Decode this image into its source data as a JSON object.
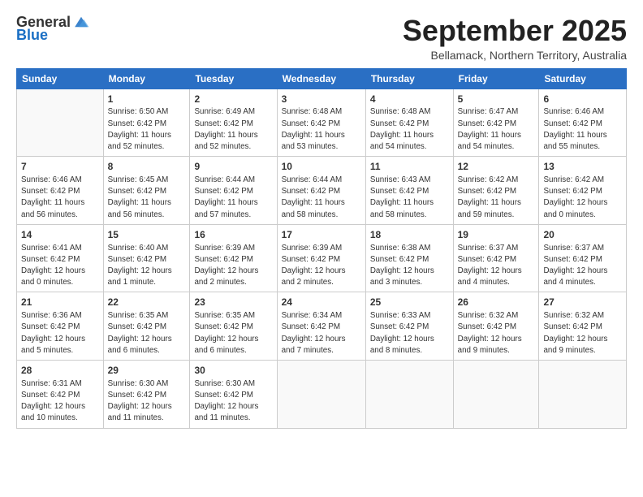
{
  "logo": {
    "general": "General",
    "blue": "Blue"
  },
  "header": {
    "month": "September 2025",
    "location": "Bellamack, Northern Territory, Australia"
  },
  "weekdays": [
    "Sunday",
    "Monday",
    "Tuesday",
    "Wednesday",
    "Thursday",
    "Friday",
    "Saturday"
  ],
  "weeks": [
    [
      {
        "day": "",
        "info": ""
      },
      {
        "day": "1",
        "info": "Sunrise: 6:50 AM\nSunset: 6:42 PM\nDaylight: 11 hours\nand 52 minutes."
      },
      {
        "day": "2",
        "info": "Sunrise: 6:49 AM\nSunset: 6:42 PM\nDaylight: 11 hours\nand 52 minutes."
      },
      {
        "day": "3",
        "info": "Sunrise: 6:48 AM\nSunset: 6:42 PM\nDaylight: 11 hours\nand 53 minutes."
      },
      {
        "day": "4",
        "info": "Sunrise: 6:48 AM\nSunset: 6:42 PM\nDaylight: 11 hours\nand 54 minutes."
      },
      {
        "day": "5",
        "info": "Sunrise: 6:47 AM\nSunset: 6:42 PM\nDaylight: 11 hours\nand 54 minutes."
      },
      {
        "day": "6",
        "info": "Sunrise: 6:46 AM\nSunset: 6:42 PM\nDaylight: 11 hours\nand 55 minutes."
      }
    ],
    [
      {
        "day": "7",
        "info": "Sunrise: 6:46 AM\nSunset: 6:42 PM\nDaylight: 11 hours\nand 56 minutes."
      },
      {
        "day": "8",
        "info": "Sunrise: 6:45 AM\nSunset: 6:42 PM\nDaylight: 11 hours\nand 56 minutes."
      },
      {
        "day": "9",
        "info": "Sunrise: 6:44 AM\nSunset: 6:42 PM\nDaylight: 11 hours\nand 57 minutes."
      },
      {
        "day": "10",
        "info": "Sunrise: 6:44 AM\nSunset: 6:42 PM\nDaylight: 11 hours\nand 58 minutes."
      },
      {
        "day": "11",
        "info": "Sunrise: 6:43 AM\nSunset: 6:42 PM\nDaylight: 11 hours\nand 58 minutes."
      },
      {
        "day": "12",
        "info": "Sunrise: 6:42 AM\nSunset: 6:42 PM\nDaylight: 11 hours\nand 59 minutes."
      },
      {
        "day": "13",
        "info": "Sunrise: 6:42 AM\nSunset: 6:42 PM\nDaylight: 12 hours\nand 0 minutes."
      }
    ],
    [
      {
        "day": "14",
        "info": "Sunrise: 6:41 AM\nSunset: 6:42 PM\nDaylight: 12 hours\nand 0 minutes."
      },
      {
        "day": "15",
        "info": "Sunrise: 6:40 AM\nSunset: 6:42 PM\nDaylight: 12 hours\nand 1 minute."
      },
      {
        "day": "16",
        "info": "Sunrise: 6:39 AM\nSunset: 6:42 PM\nDaylight: 12 hours\nand 2 minutes."
      },
      {
        "day": "17",
        "info": "Sunrise: 6:39 AM\nSunset: 6:42 PM\nDaylight: 12 hours\nand 2 minutes."
      },
      {
        "day": "18",
        "info": "Sunrise: 6:38 AM\nSunset: 6:42 PM\nDaylight: 12 hours\nand 3 minutes."
      },
      {
        "day": "19",
        "info": "Sunrise: 6:37 AM\nSunset: 6:42 PM\nDaylight: 12 hours\nand 4 minutes."
      },
      {
        "day": "20",
        "info": "Sunrise: 6:37 AM\nSunset: 6:42 PM\nDaylight: 12 hours\nand 4 minutes."
      }
    ],
    [
      {
        "day": "21",
        "info": "Sunrise: 6:36 AM\nSunset: 6:42 PM\nDaylight: 12 hours\nand 5 minutes."
      },
      {
        "day": "22",
        "info": "Sunrise: 6:35 AM\nSunset: 6:42 PM\nDaylight: 12 hours\nand 6 minutes."
      },
      {
        "day": "23",
        "info": "Sunrise: 6:35 AM\nSunset: 6:42 PM\nDaylight: 12 hours\nand 6 minutes."
      },
      {
        "day": "24",
        "info": "Sunrise: 6:34 AM\nSunset: 6:42 PM\nDaylight: 12 hours\nand 7 minutes."
      },
      {
        "day": "25",
        "info": "Sunrise: 6:33 AM\nSunset: 6:42 PM\nDaylight: 12 hours\nand 8 minutes."
      },
      {
        "day": "26",
        "info": "Sunrise: 6:32 AM\nSunset: 6:42 PM\nDaylight: 12 hours\nand 9 minutes."
      },
      {
        "day": "27",
        "info": "Sunrise: 6:32 AM\nSunset: 6:42 PM\nDaylight: 12 hours\nand 9 minutes."
      }
    ],
    [
      {
        "day": "28",
        "info": "Sunrise: 6:31 AM\nSunset: 6:42 PM\nDaylight: 12 hours\nand 10 minutes."
      },
      {
        "day": "29",
        "info": "Sunrise: 6:30 AM\nSunset: 6:42 PM\nDaylight: 12 hours\nand 11 minutes."
      },
      {
        "day": "30",
        "info": "Sunrise: 6:30 AM\nSunset: 6:42 PM\nDaylight: 12 hours\nand 11 minutes."
      },
      {
        "day": "",
        "info": ""
      },
      {
        "day": "",
        "info": ""
      },
      {
        "day": "",
        "info": ""
      },
      {
        "day": "",
        "info": ""
      }
    ]
  ]
}
